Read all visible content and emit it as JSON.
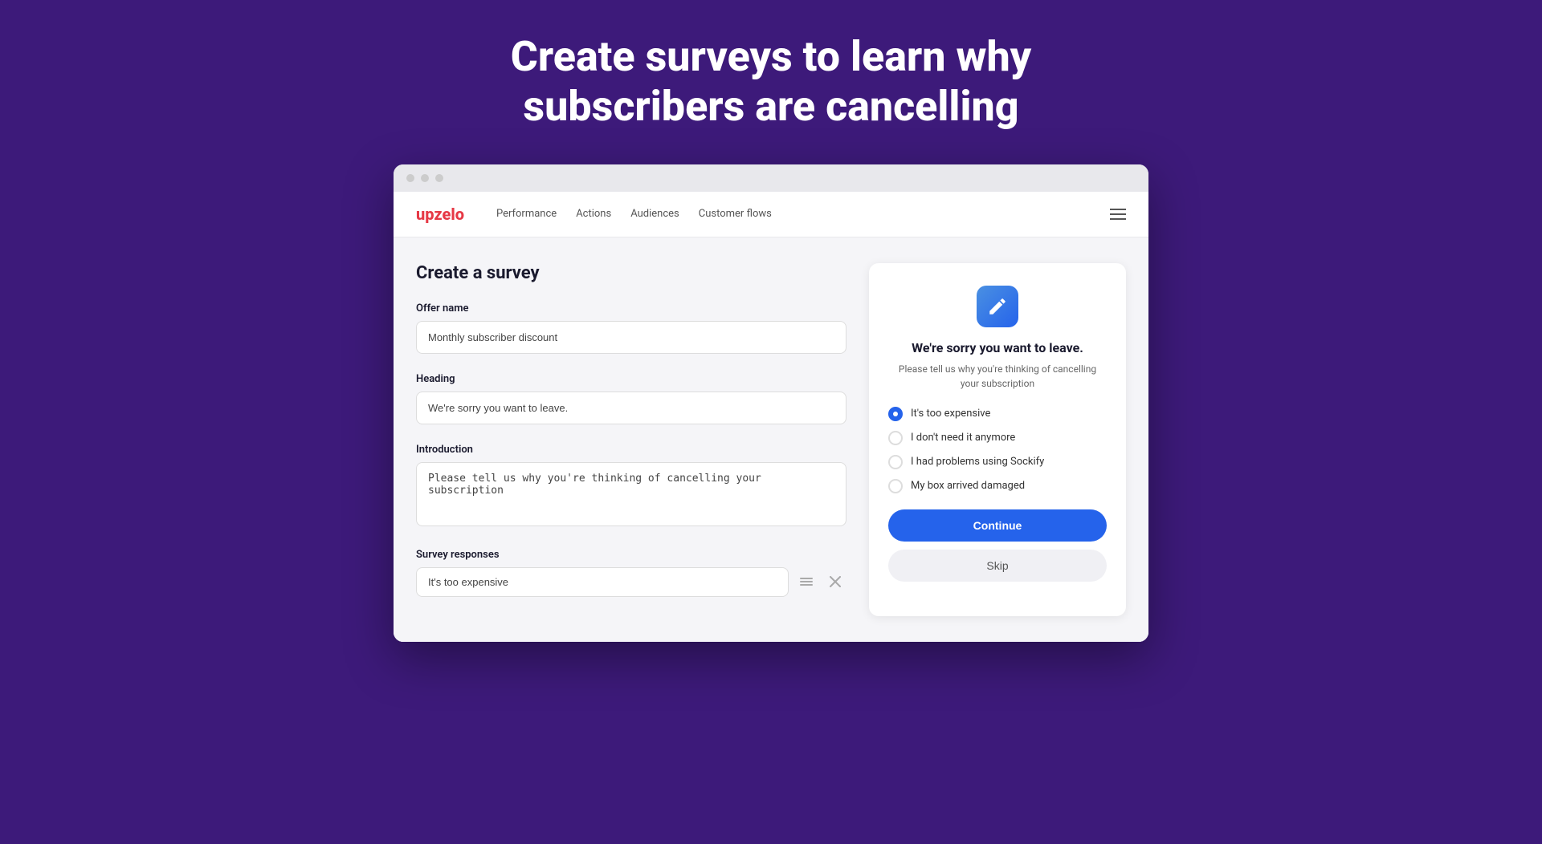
{
  "hero": {
    "title": "Create surveys to learn why subscribers are cancelling"
  },
  "nav": {
    "logo_text": "up",
    "logo_accent": "zelo",
    "links": [
      "Performance",
      "Actions",
      "Audiences",
      "Customer flows"
    ],
    "menu_icon": "menu-icon"
  },
  "form": {
    "page_title": "Create a survey",
    "offer_name_label": "Offer name",
    "offer_name_value": "Monthly subscriber discount",
    "heading_label": "Heading",
    "heading_value": "We're sorry you want to leave.",
    "introduction_label": "Introduction",
    "introduction_value": "Please tell us why you're thinking of cancelling your subscription",
    "survey_responses_label": "Survey responses",
    "response_1": "It's too expensive"
  },
  "preview": {
    "heading": "We're sorry you want to leave.",
    "intro": "Please tell us why you're thinking of cancelling your subscription",
    "options": [
      {
        "label": "It's too expensive",
        "selected": true
      },
      {
        "label": "I don't need it anymore",
        "selected": false
      },
      {
        "label": "I had problems using Sockify",
        "selected": false
      },
      {
        "label": "My box arrived damaged",
        "selected": false
      }
    ],
    "continue_label": "Continue",
    "skip_label": "Skip"
  },
  "browser": {
    "dots": [
      "dot1",
      "dot2",
      "dot3"
    ]
  }
}
